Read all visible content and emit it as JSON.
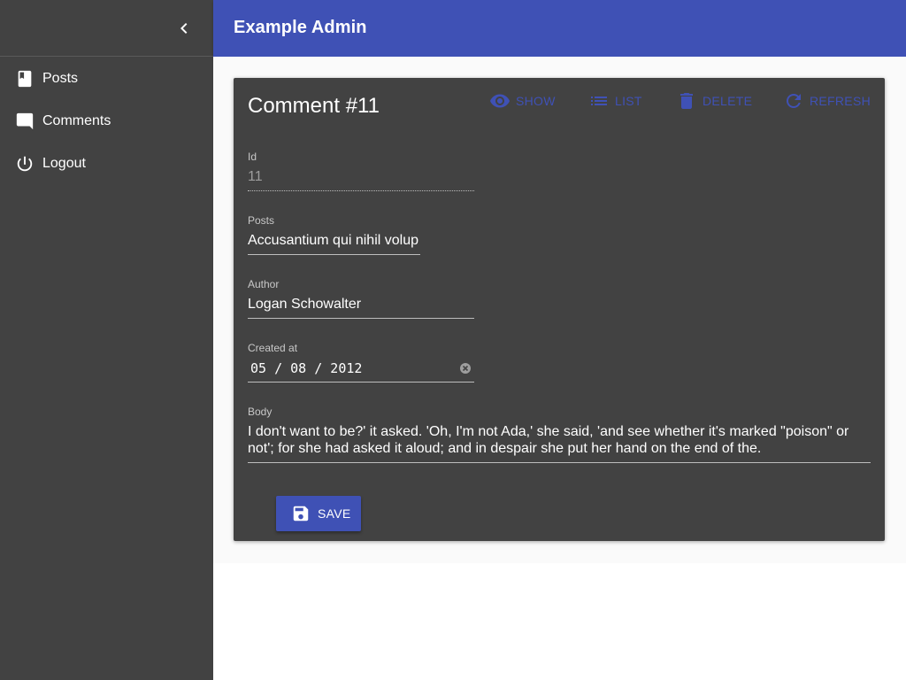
{
  "app": {
    "title": "Example Admin"
  },
  "sidebar": {
    "collapse_icon": "chevron-left-icon",
    "items": [
      {
        "label": "Posts",
        "icon": "book-icon"
      },
      {
        "label": "Comments",
        "icon": "comment-icon"
      },
      {
        "label": "Logout",
        "icon": "power-icon"
      }
    ]
  },
  "page": {
    "title": "Comment #11",
    "actions": [
      {
        "label": "SHOW",
        "icon": "eye-icon"
      },
      {
        "label": "LIST",
        "icon": "list-icon"
      },
      {
        "label": "DELETE",
        "icon": "trash-icon"
      },
      {
        "label": "REFRESH",
        "icon": "refresh-icon"
      }
    ]
  },
  "form": {
    "id": {
      "label": "Id",
      "value": "11"
    },
    "posts": {
      "label": "Posts",
      "value": "Accusantium qui nihil volup"
    },
    "author": {
      "label": "Author",
      "value": "Logan Schowalter"
    },
    "created_at": {
      "label": "Created at",
      "value": "05 / 08 / 2012"
    },
    "body": {
      "label": "Body",
      "value": "I don't want to be?' it asked. 'Oh, I'm not Ada,' she said, 'and see whether it's marked \"poison\" or not'; for she had asked it aloud; and in despair she put her hand on the end of the."
    },
    "save_label": "SAVE"
  },
  "colors": {
    "primary": "#3f51b5",
    "sidebar_bg": "#424242",
    "card_bg": "#424242"
  }
}
